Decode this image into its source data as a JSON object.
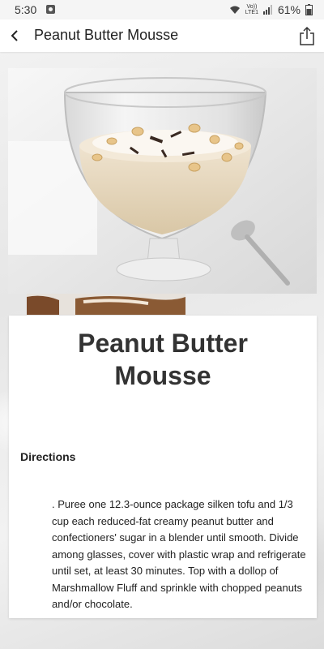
{
  "status_bar": {
    "time": "5:30",
    "network_label_top": "Vo))",
    "network_label_bottom": "LTE1",
    "battery": "61%"
  },
  "app_bar": {
    "title": "Peanut Butter Mousse",
    "back_icon": "chevron-left-icon",
    "share_icon": "share-icon"
  },
  "hero_image": {
    "subject": "peanut butter mousse dessert glass"
  },
  "recipe": {
    "title": "Peanut Butter\nMousse",
    "directions_heading": "Directions",
    "directions_text": ". Puree one 12.3-ounce package silken tofu and 1/3 cup each reduced-fat creamy peanut butter and confectioners' sugar in a blender until smooth. Divide among glasses, cover with plastic wrap and refrigerate until set, at least 30 minutes. Top with a dollop of Marshmallow Fluff and sprinkle with chopped peanuts and/or chocolate."
  },
  "colors": {
    "card": "#ffffff",
    "text": "#333333",
    "mousse": "#e8d9c0"
  }
}
